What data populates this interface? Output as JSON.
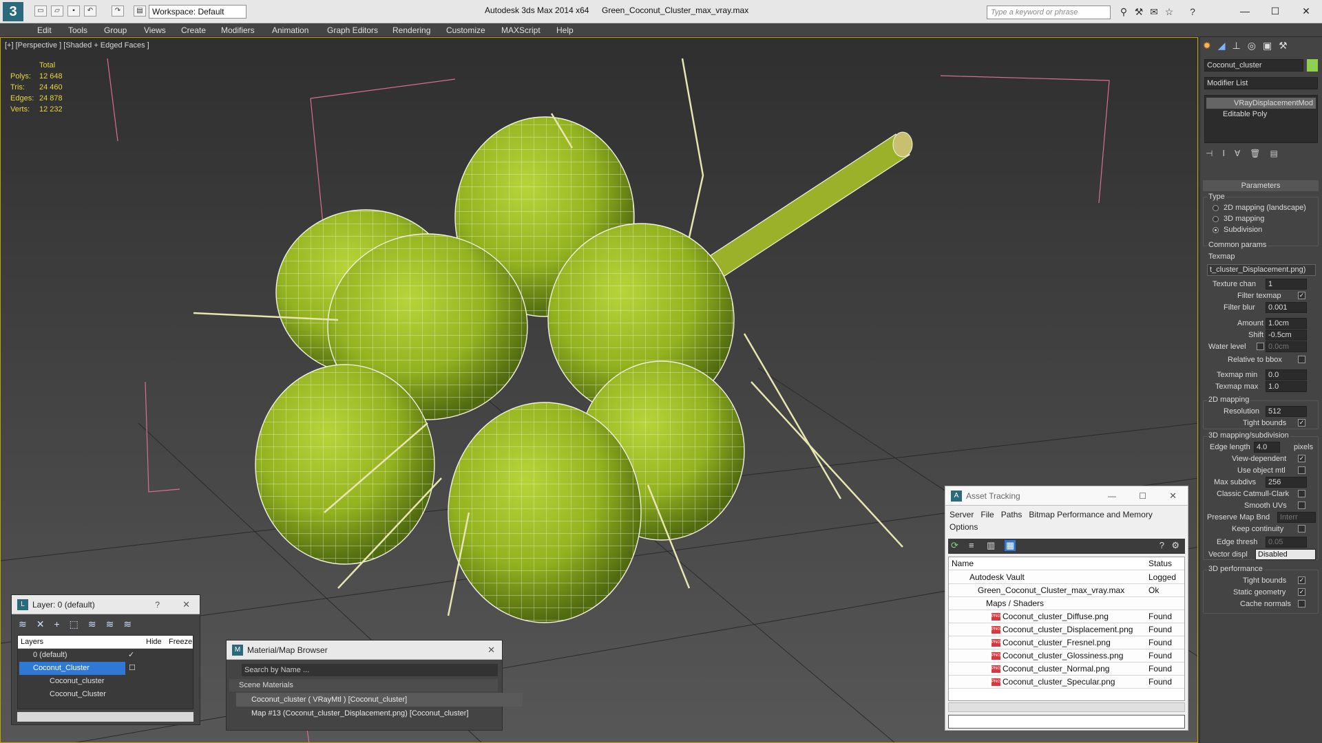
{
  "titlebar": {
    "app_title": "Autodesk 3ds Max  2014 x64",
    "file_title": "Green_Coconut_Cluster_max_vray.max",
    "workspace": "Workspace: Default",
    "search_placeholder": "Type a keyword or phrase",
    "logo_glyph": "3"
  },
  "menubar": [
    "Edit",
    "Tools",
    "Group",
    "Views",
    "Create",
    "Modifiers",
    "Animation",
    "Graph Editors",
    "Rendering",
    "Customize",
    "MAXScript",
    "Help"
  ],
  "viewport": {
    "label": "[+] [Perspective ] [Shaded + Edged Faces ]",
    "stats_header": "Total",
    "stats": [
      {
        "key": "Polys:",
        "value": "12 648"
      },
      {
        "key": "Tris:",
        "value": "24 460"
      },
      {
        "key": "Edges:",
        "value": "24 878"
      },
      {
        "key": "Verts:",
        "value": "12 232"
      }
    ]
  },
  "command_panel": {
    "object_name": "Coconut_cluster",
    "object_color": "#8fd14f",
    "modifier_list": "Modifier List",
    "stack": [
      {
        "label": "VRayDisplacementMod",
        "selected": true
      },
      {
        "label": "Editable Poly",
        "selected": false
      }
    ],
    "parameters_title": "Parameters",
    "type_group": "Type",
    "type_options": [
      {
        "label": "2D mapping (landscape)",
        "checked": false
      },
      {
        "label": "3D mapping",
        "checked": false
      },
      {
        "label": "Subdivision",
        "checked": true
      }
    ],
    "common_params": "Common params",
    "texmap_label": "Texmap",
    "texmap_value": "t_cluster_Displacement.png)",
    "texture_chan_label": "Texture chan",
    "texture_chan": "1",
    "filter_texmap": "Filter texmap",
    "filter_blur_label": "Filter blur",
    "filter_blur": "0.001",
    "amount_label": "Amount",
    "amount": "1.0cm",
    "shift_label": "Shift",
    "shift": "-0.5cm",
    "water_level_label": "Water level",
    "water_level": "0.0cm",
    "relative_bbox": "Relative to bbox",
    "texmap_min_label": "Texmap min",
    "texmap_min": "0.0",
    "texmap_max_label": "Texmap max",
    "texmap_max": "1.0",
    "mapping2d_group": "2D mapping",
    "resolution_label": "Resolution",
    "resolution": "512",
    "tight_bounds": "Tight bounds",
    "mapping3d_group": "3D mapping/subdivision",
    "edge_length_label": "Edge length",
    "edge_length": "4.0",
    "pixels": "pixels",
    "view_dependent": "View-dependent",
    "use_object_mtl": "Use object mtl",
    "max_subdivs_label": "Max subdivs",
    "max_subdivs": "256",
    "classic_cc": "Classic Catmull-Clark",
    "smooth_uvs": "Smooth UVs",
    "preserve_map_bnd": "Preserve Map Bnd",
    "preserve_map_value": "Interr",
    "keep_continuity": "Keep continuity",
    "edge_thresh_label": "Edge thresh",
    "edge_thresh": "0.05",
    "vector_displ_label": "Vector displ",
    "vector_displ": "Disabled",
    "perf_group": "3D performance",
    "tight_bounds2": "Tight bounds",
    "static_geometry": "Static geometry",
    "cache_normals": "Cache normals"
  },
  "layer_panel": {
    "title": "Layer: 0 (default)",
    "help": "?",
    "close": "✕",
    "col_layers": "Layers",
    "col_hide": "Hide",
    "col_freeze": "Freeze",
    "rows": [
      {
        "label": "0 (default)",
        "indent": 1
      },
      {
        "label": "Coconut_Cluster",
        "indent": 1
      },
      {
        "label": "Coconut_cluster",
        "indent": 2
      },
      {
        "label": "Coconut_Cluster",
        "indent": 2
      }
    ]
  },
  "material_browser": {
    "title": "Material/Map Browser",
    "close": "✕",
    "search_placeholder": "Search by Name ...",
    "group": "Scene Materials",
    "items": [
      "Coconut_cluster  ( VRayMtl )  [Coconut_cluster]",
      "Map #13 (Coconut_cluster_Displacement.png)  [Coconut_cluster]"
    ]
  },
  "asset_tracking": {
    "title": "Asset Tracking",
    "menu": [
      "Server",
      "File",
      "Paths",
      "Bitmap Performance and Memory",
      "Options"
    ],
    "col_name": "Name",
    "col_status": "Status",
    "rows": [
      {
        "name": "Autodesk Vault",
        "status": "Logged O",
        "indent": 1,
        "icon": "vault"
      },
      {
        "name": "Green_Coconut_Cluster_max_vray.max",
        "status": "Ok",
        "indent": 2,
        "icon": "max"
      },
      {
        "name": "Maps / Shaders",
        "status": "",
        "indent": 3,
        "icon": "folder"
      },
      {
        "name": "Coconut_cluster_Diffuse.png",
        "status": "Found",
        "indent": 4,
        "icon": "png"
      },
      {
        "name": "Coconut_cluster_Displacement.png",
        "status": "Found",
        "indent": 4,
        "icon": "png"
      },
      {
        "name": "Coconut_cluster_Fresnel.png",
        "status": "Found",
        "indent": 4,
        "icon": "png"
      },
      {
        "name": "Coconut_cluster_Glossiness.png",
        "status": "Found",
        "indent": 4,
        "icon": "png"
      },
      {
        "name": "Coconut_cluster_Normal.png",
        "status": "Found",
        "indent": 4,
        "icon": "png"
      },
      {
        "name": "Coconut_cluster_Specular.png",
        "status": "Found",
        "indent": 4,
        "icon": "png"
      }
    ]
  }
}
